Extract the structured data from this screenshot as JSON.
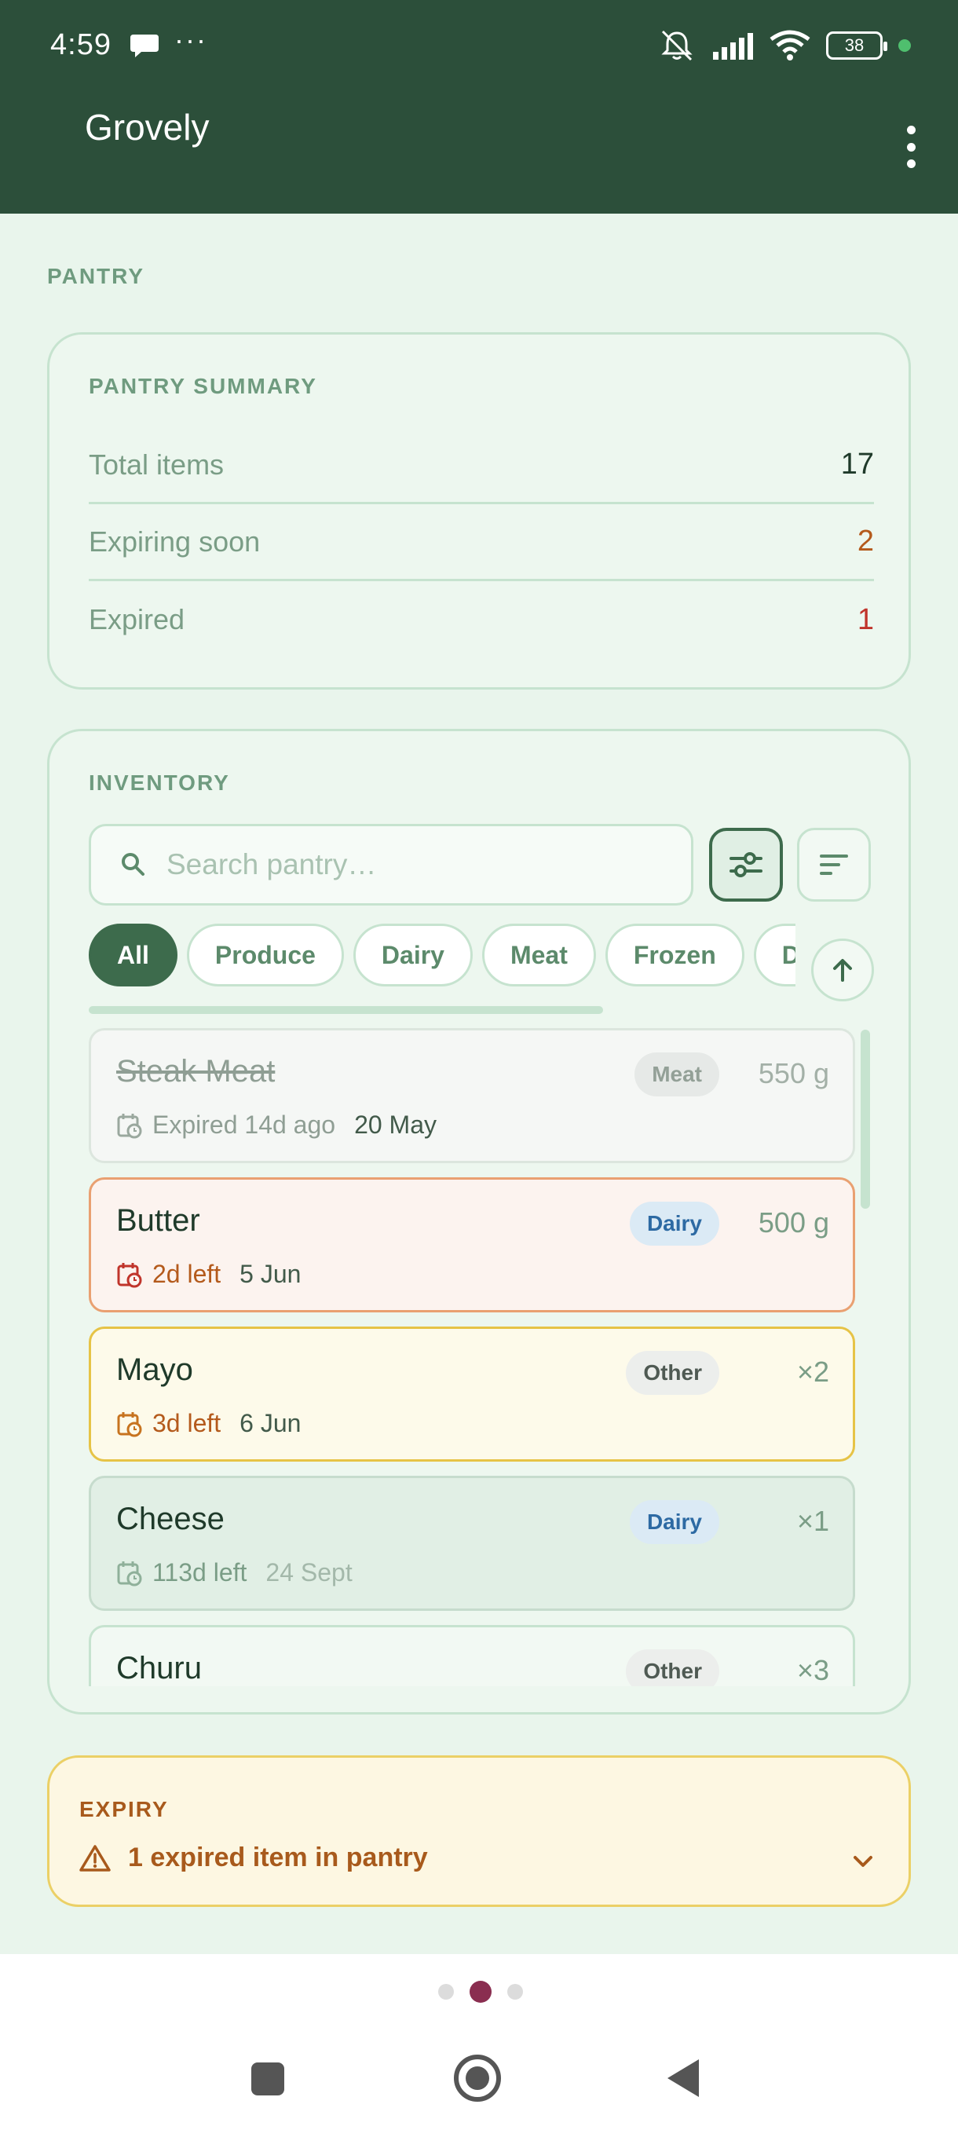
{
  "status_bar": {
    "time": "4:59",
    "more": "···",
    "battery": "38"
  },
  "app": {
    "title": "Grovely"
  },
  "section": {
    "label": "PANTRY"
  },
  "summary": {
    "title": "PANTRY SUMMARY",
    "rows": [
      {
        "label": "Total items",
        "value": "17"
      },
      {
        "label": "Expiring soon",
        "value": "2"
      },
      {
        "label": "Expired",
        "value": "1"
      }
    ]
  },
  "inventory": {
    "title": "INVENTORY",
    "search_placeholder": "Search pantry…",
    "chips": [
      "All",
      "Produce",
      "Dairy",
      "Meat",
      "Frozen",
      "D"
    ],
    "items": [
      {
        "name": "Steak Meat",
        "category": "Meat",
        "qty": "550 g",
        "relative": "Expired 14d ago",
        "date": "20 May"
      },
      {
        "name": "Butter",
        "category": "Dairy",
        "qty": "500 g",
        "relative": "2d left",
        "date": "5 Jun"
      },
      {
        "name": "Mayo",
        "category": "Other",
        "qty": "×2",
        "relative": "3d left",
        "date": "6 Jun"
      },
      {
        "name": "Cheese",
        "category": "Dairy",
        "qty": "×1",
        "relative": "113d left",
        "date": "24 Sept"
      },
      {
        "name": "Churu",
        "category": "Other",
        "qty": "×3"
      }
    ]
  },
  "expiry": {
    "title": "EXPIRY",
    "message": "1 expired item in pantry"
  },
  "colors": {
    "primary": "#2c4f3a",
    "accent": "#3d6b4c",
    "expired": "#c0342b",
    "warning": "#b45a1c"
  }
}
